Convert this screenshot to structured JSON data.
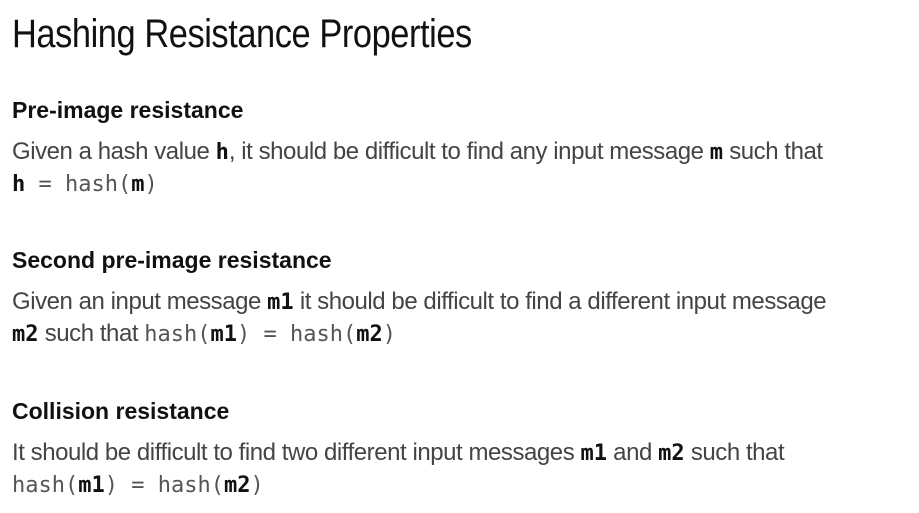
{
  "title": "Hashing Resistance Properties",
  "sections": [
    {
      "heading": "Pre-image resistance",
      "lines": [
        [
          {
            "text": "Given a hash value ",
            "style": "text"
          },
          {
            "text": "h",
            "style": "var"
          },
          {
            "text": ", it should be difficult to find any input message ",
            "style": "text"
          },
          {
            "text": "m",
            "style": "var"
          },
          {
            "text": " such that",
            "style": "text"
          }
        ],
        [
          {
            "text": "h",
            "style": "var"
          },
          {
            "text": " = hash(",
            "style": "code"
          },
          {
            "text": "m",
            "style": "var"
          },
          {
            "text": ")",
            "style": "code"
          }
        ]
      ]
    },
    {
      "heading": "Second pre-image resistance",
      "lines": [
        [
          {
            "text": "Given an input message ",
            "style": "text"
          },
          {
            "text": "m1",
            "style": "var"
          },
          {
            "text": " it should be difficult to find a different input message",
            "style": "text"
          }
        ],
        [
          {
            "text": "m2",
            "style": "var"
          },
          {
            "text": " such that ",
            "style": "text"
          },
          {
            "text": "hash(",
            "style": "code"
          },
          {
            "text": "m1",
            "style": "var"
          },
          {
            "text": ") = hash(",
            "style": "code"
          },
          {
            "text": "m2",
            "style": "var"
          },
          {
            "text": ")",
            "style": "code"
          }
        ]
      ]
    },
    {
      "heading": "Collision resistance",
      "lines": [
        [
          {
            "text": "It should be difficult to find two different input messages ",
            "style": "text"
          },
          {
            "text": "m1",
            "style": "var"
          },
          {
            "text": " and ",
            "style": "text"
          },
          {
            "text": "m2",
            "style": "var"
          },
          {
            "text": " such that",
            "style": "text"
          }
        ],
        [
          {
            "text": "hash(",
            "style": "code"
          },
          {
            "text": "m1",
            "style": "var"
          },
          {
            "text": ") = hash(",
            "style": "code"
          },
          {
            "text": "m2",
            "style": "var"
          },
          {
            "text": ")",
            "style": "code"
          }
        ]
      ]
    }
  ]
}
